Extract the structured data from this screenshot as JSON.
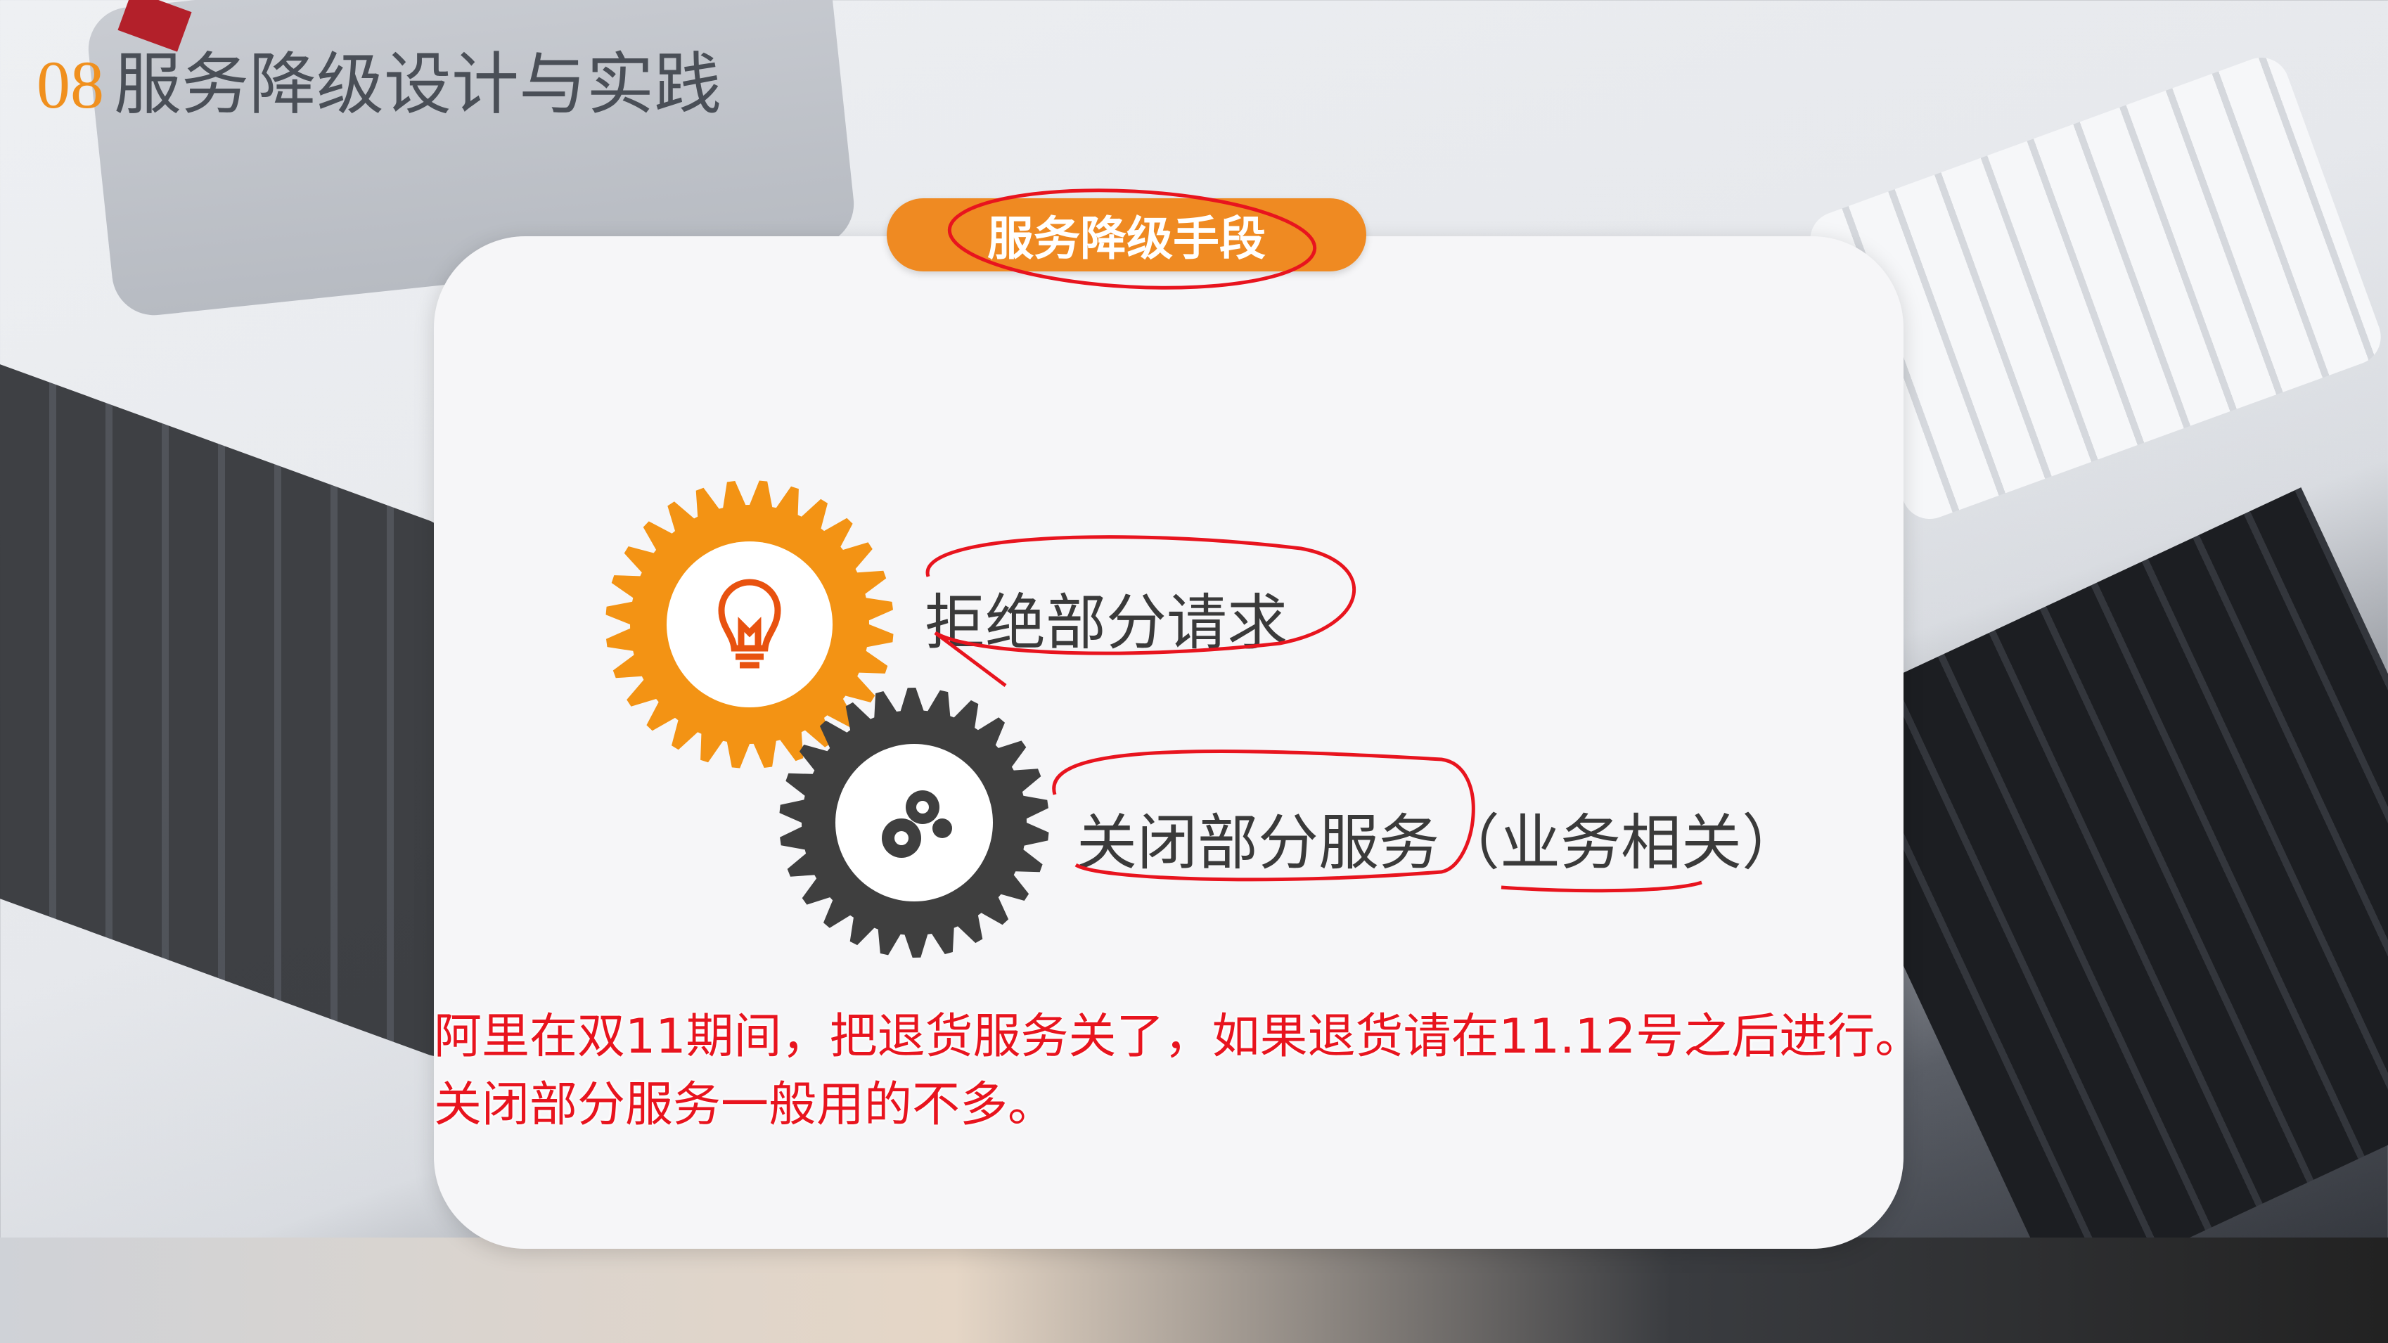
{
  "header": {
    "number": "08",
    "title": "服务降级设计与实践"
  },
  "card": {
    "badge": "服务降级手段",
    "items": [
      {
        "label": "拒绝部分请求",
        "icon": "lightbulb-icon"
      },
      {
        "label": "关闭部分服务（业务相关）",
        "icon": "gears-icon"
      }
    ]
  },
  "notes": [
    "阿里在双11期间，把退货服务关了，如果退货请在11.12号之后进行。",
    "关闭部分服务一般用的不多。"
  ],
  "colors": {
    "accent": "#ef8a22",
    "gear_dark": "#3f3f3f",
    "annotation": "#e8141e"
  }
}
